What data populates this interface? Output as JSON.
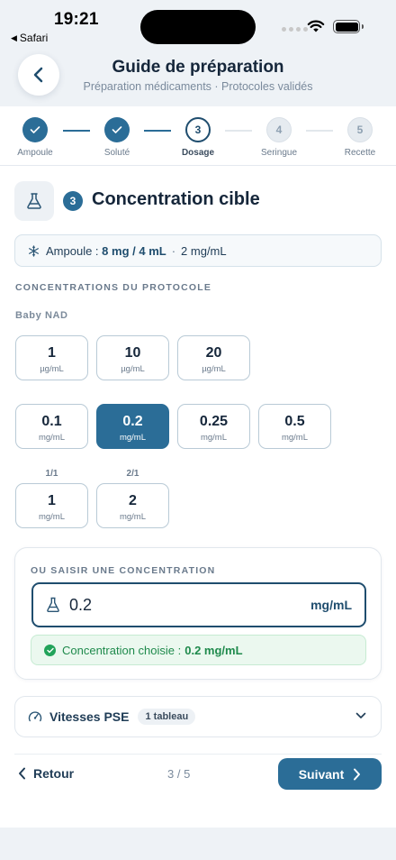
{
  "status": {
    "time": "19:21",
    "back_app": "Safari"
  },
  "header": {
    "title": "Guide de préparation",
    "subtitle": "Préparation médicaments · Protocoles validés"
  },
  "steps": [
    {
      "num": "1",
      "label": "Ampoule",
      "state": "done"
    },
    {
      "num": "2",
      "label": "Soluté",
      "state": "done"
    },
    {
      "num": "3",
      "label": "Dosage",
      "state": "current"
    },
    {
      "num": "4",
      "label": "Seringue",
      "state": "todo"
    },
    {
      "num": "5",
      "label": "Recette",
      "state": "todo"
    }
  ],
  "section": {
    "num": "3",
    "title": "Concentration cible"
  },
  "ampoule": {
    "prefix": "Ampoule :",
    "value": "8 mg / 4 mL",
    "separator": "·",
    "concentration": "2 mg/mL"
  },
  "protocol": {
    "label": "CONCENTRATIONS DU PROTOCOLE",
    "group": "Baby NAD",
    "row1": [
      {
        "value": "1",
        "unit": "µg/mL"
      },
      {
        "value": "10",
        "unit": "µg/mL"
      },
      {
        "value": "20",
        "unit": "µg/mL"
      }
    ],
    "row2": [
      {
        "value": "0.1",
        "unit": "mg/mL"
      },
      {
        "value": "0.2",
        "unit": "mg/mL"
      },
      {
        "value": "0.25",
        "unit": "mg/mL"
      },
      {
        "value": "0.5",
        "unit": "mg/mL"
      }
    ],
    "row3": [
      {
        "ratio": "1/1",
        "value": "1",
        "unit": "mg/mL"
      },
      {
        "ratio": "2/1",
        "value": "2",
        "unit": "mg/mL"
      }
    ]
  },
  "custom": {
    "label": "OU SAISIR UNE CONCENTRATION",
    "value": "0.2",
    "unit": "mg/mL",
    "confirm_prefix": "Concentration choisie :",
    "confirm_value": "0.2 mg/mL"
  },
  "pse": {
    "label": "Vitesses PSE",
    "badge": "1 tableau"
  },
  "nav": {
    "back": "Retour",
    "pager": "3 / 5",
    "next": "Suivant"
  },
  "colors": {
    "accent": "#2b6d97",
    "dark_accent": "#1f4d6e",
    "success": "#22a35a"
  }
}
